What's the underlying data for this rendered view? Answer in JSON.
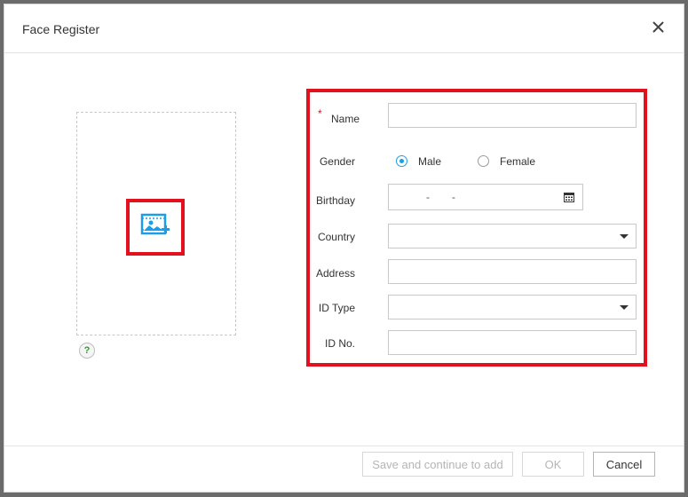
{
  "dialog": {
    "title": "Face Register",
    "close_icon": "close-icon"
  },
  "photo": {
    "upload_icon": "add-image-icon",
    "help_icon": "question-icon",
    "help_glyph": "?"
  },
  "form": {
    "name": {
      "label": "Name",
      "required_mark": "*",
      "value": ""
    },
    "gender": {
      "label": "Gender",
      "options": [
        "Male",
        "Female"
      ],
      "selected": "Male"
    },
    "birthday": {
      "label": "Birthday",
      "sep1": "-",
      "sep2": "-",
      "icon": "calendar-icon"
    },
    "country": {
      "label": "Country",
      "value": ""
    },
    "address": {
      "label": "Address",
      "value": ""
    },
    "id_type": {
      "label": "ID Type",
      "value": ""
    },
    "id_no": {
      "label": "ID No.",
      "value": ""
    }
  },
  "footer": {
    "save_continue_label": "Save and continue to add",
    "ok_label": "OK",
    "cancel_label": "Cancel"
  },
  "colors": {
    "accent": "#1a9ee8",
    "highlight": "#e3101e"
  }
}
